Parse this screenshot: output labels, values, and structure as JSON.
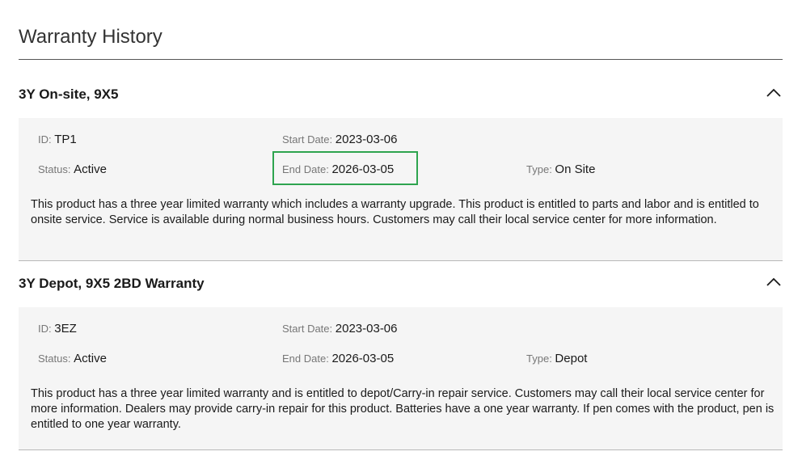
{
  "page": {
    "title": "Warranty History"
  },
  "warranties": [
    {
      "title": "3Y On-site, 9X5",
      "id_label": "ID",
      "id_value": "TP1",
      "start_label": "Start Date",
      "start_value": "2023-03-06",
      "status_label": "Status",
      "status_value": "Active",
      "end_label": "End Date",
      "end_value": "2026-03-05",
      "type_label": "Type",
      "type_value": "On Site",
      "description": "This product has a three year limited warranty which includes a warranty upgrade. This product is entitled to parts and labor and is entitled to onsite service. Service is available during normal business hours. Customers may call their local service center for more information."
    },
    {
      "title": "3Y Depot, 9X5 2BD Warranty",
      "id_label": "ID",
      "id_value": "3EZ",
      "start_label": "Start Date",
      "start_value": "2023-03-06",
      "status_label": "Status",
      "status_value": "Active",
      "end_label": "End Date",
      "end_value": "2026-03-05",
      "type_label": "Type",
      "type_value": "Depot",
      "description": "This product has a three year limited warranty and is entitled to depot/Carry-in repair service. Customers may call their local service center for more information. Dealers may provide carry-in repair for this product. Batteries have a one year warranty. If pen comes with the product, pen is entitled to one year warranty."
    }
  ],
  "icons": {
    "collapse": "chevron-up-icon"
  },
  "colors": {
    "highlight": "#2ea44f",
    "card_background": "#f5f5f5"
  }
}
